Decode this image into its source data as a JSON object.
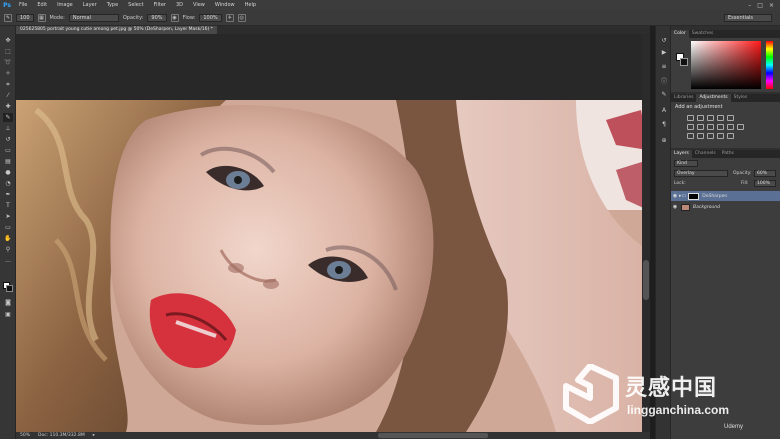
{
  "app": {
    "logo": "Ps",
    "menus": [
      "File",
      "Edit",
      "Image",
      "Layer",
      "Type",
      "Select",
      "Filter",
      "3D",
      "View",
      "Window",
      "Help"
    ],
    "window_controls": [
      "–",
      "□",
      "×"
    ]
  },
  "options": {
    "brush_size": "100",
    "mode_label": "Mode:",
    "mode_value": "Normal",
    "opacity_label": "Opacity:",
    "opacity_value": "90%",
    "flow_label": "Flow:",
    "flow_value": "100%",
    "workspace": "Essentials"
  },
  "document": {
    "tab_title": "025625805 portrait young cutie among pet.jpg @ 50% (DeSharpen, Layer Mask/16) *",
    "zoom": "50%",
    "doc_info": "Doc: 110.3M/332.8M"
  },
  "panels": {
    "color_tabs": [
      "Color",
      "Swatches"
    ],
    "adjust_tabs": [
      "Libraries",
      "Adjustments",
      "Styles"
    ],
    "adjust_title": "Add an adjustment",
    "layers_tabs": [
      "Layers",
      "Channels",
      "Paths"
    ],
    "kind_label": "Kind",
    "blend_mode": "Overlay",
    "opacity_label": "Opacity:",
    "opacity_value": "60%",
    "lock_label": "Lock:",
    "fill_label": "Fill:",
    "fill_value": "100%",
    "layers": [
      {
        "name": "DeSharpen",
        "selected": true
      },
      {
        "name": "Background",
        "selected": false
      }
    ]
  },
  "watermark": {
    "cn": "灵感中国",
    "en": "lingganchina.com",
    "udemy": "Udemy"
  },
  "icons": [
    "brush-icon",
    "eye-icon",
    "folder-icon",
    "lock-icon"
  ],
  "colors": {
    "accent": "#31a8ff",
    "selection": "#5a7094",
    "foreground": "#ffffff",
    "background": "#111111"
  }
}
